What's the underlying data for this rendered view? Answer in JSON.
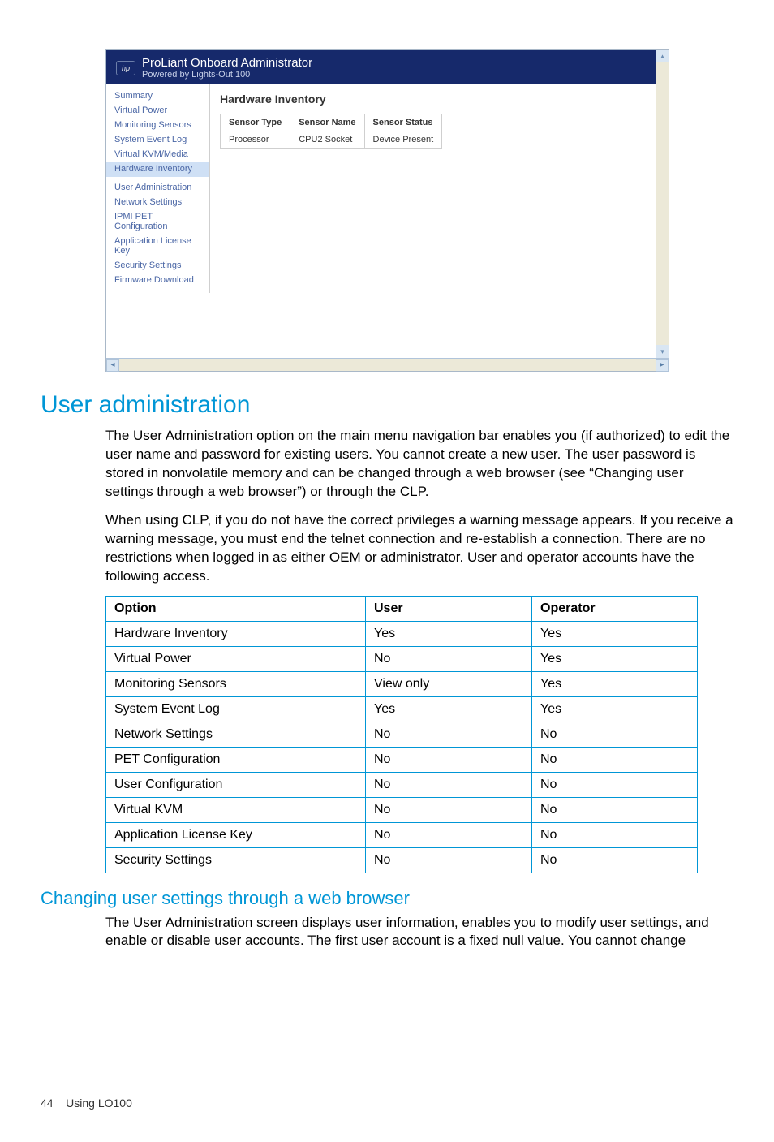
{
  "screenshot": {
    "brand_title": "ProLiant Onboard Administrator",
    "brand_sub": "Powered by Lights-Out 100",
    "nav": [
      "Summary",
      "Virtual Power",
      "Monitoring Sensors",
      "System Event Log",
      "Virtual KVM/Media",
      "Hardware Inventory",
      "User Administration",
      "Network Settings",
      "IPMI PET Configuration",
      "Application License Key",
      "Security Settings",
      "Firmware Download"
    ],
    "selected_nav_index": 5,
    "content_heading": "Hardware Inventory",
    "table": {
      "headers": [
        "Sensor Type",
        "Sensor Name",
        "Sensor Status"
      ],
      "rows": [
        [
          "Processor",
          "CPU2 Socket",
          "Device Present"
        ]
      ]
    }
  },
  "doc": {
    "h1": "User administration",
    "p1": "The User Administration option on the main menu navigation bar enables you (if authorized) to edit the user name and password for existing users. You cannot create a new user. The user password is stored in nonvolatile memory and can be changed through a web browser (see “Changing user settings through a web browser”) or through the CLP.",
    "p2": "When using CLP, if you do not have the correct privileges a warning message appears. If you receive a warning message, you must end the telnet connection and re-establish a connection. There are no restrictions when logged in as either OEM or administrator. User and operator accounts have the following access.",
    "perm_table": {
      "headers": [
        "Option",
        "User",
        "Operator"
      ],
      "rows": [
        [
          "Hardware Inventory",
          "Yes",
          "Yes"
        ],
        [
          "Virtual Power",
          "No",
          "Yes"
        ],
        [
          "Monitoring Sensors",
          "View only",
          "Yes"
        ],
        [
          "System Event Log",
          "Yes",
          "Yes"
        ],
        [
          "Network Settings",
          "No",
          "No"
        ],
        [
          "PET Configuration",
          "No",
          "No"
        ],
        [
          "User Configuration",
          "No",
          "No"
        ],
        [
          "Virtual KVM",
          "No",
          "No"
        ],
        [
          "Application License Key",
          "No",
          "No"
        ],
        [
          "Security Settings",
          "No",
          "No"
        ]
      ]
    },
    "h2": "Changing user settings through a web browser",
    "p3": "The User Administration screen displays user information, enables you to modify user settings, and enable or disable user accounts. The first user account is a fixed null value. You cannot change"
  },
  "footer": {
    "page_number": "44",
    "section": "Using LO100"
  }
}
